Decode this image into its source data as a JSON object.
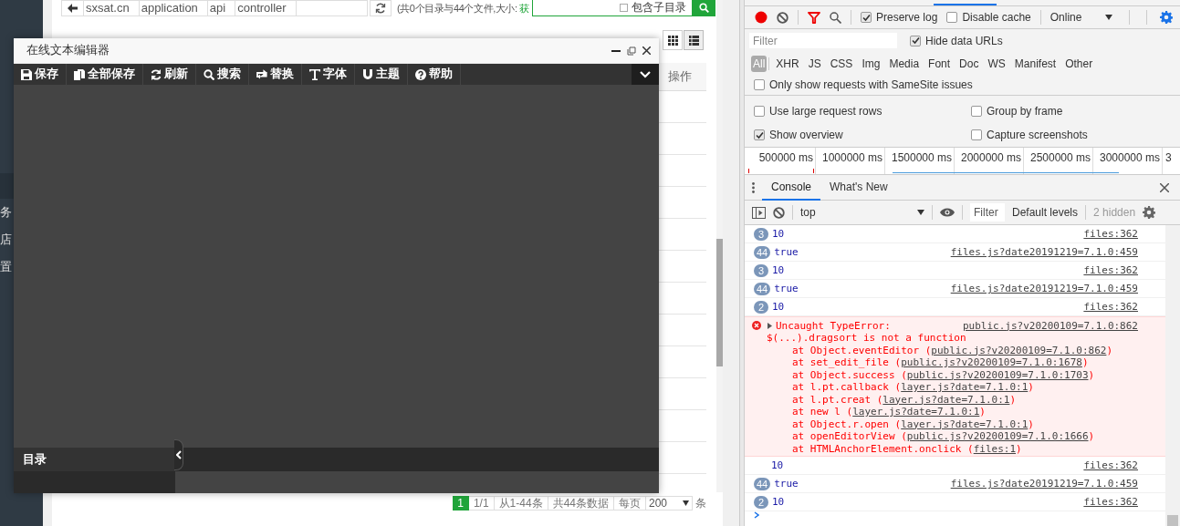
{
  "page": {
    "sidebar_items": [
      "务",
      "店",
      "置"
    ],
    "breadcrumb": [
      "sxsat.cn",
      "application",
      "api",
      "controller"
    ],
    "summary": "(共0个目录与44个文件,大小: ",
    "summary_link": "获",
    "search": {
      "option": "包含子目录",
      "checked": false
    },
    "view_modes": [
      {
        "kind": "grid",
        "selected": false
      },
      {
        "kind": "list",
        "selected": true
      }
    ],
    "table": {
      "columns": [
        "操作"
      ]
    },
    "pagination": {
      "current": "1",
      "pages": "1/1",
      "range": "从1-44条",
      "total": "共44条数据",
      "per_page_label": "每页",
      "per_page": "200",
      "unit": "条"
    }
  },
  "editor": {
    "title": "在线文本编辑器",
    "toolbar": [
      "保存",
      "全部保存",
      "刷新",
      "搜索",
      "替换",
      "字体",
      "主题",
      "帮助"
    ],
    "sidebar_title": "目录"
  },
  "devtools": {
    "network": {
      "toolbar_checks": [
        {
          "label": "Preserve log",
          "checked": true
        },
        {
          "label": "Disable cache",
          "checked": false
        }
      ],
      "throttle": "Online",
      "filter_placeholder": "Filter",
      "hide_data_urls": {
        "label": "Hide data URLs",
        "checked": true
      },
      "types": [
        {
          "label": "All",
          "selected": true
        },
        {
          "label": "XHR",
          "selected": false
        },
        {
          "label": "JS",
          "selected": false
        },
        {
          "label": "CSS",
          "selected": false
        },
        {
          "label": "Img",
          "selected": false
        },
        {
          "label": "Media",
          "selected": false
        },
        {
          "label": "Font",
          "selected": false
        },
        {
          "label": "Doc",
          "selected": false
        },
        {
          "label": "WS",
          "selected": false
        },
        {
          "label": "Manifest",
          "selected": false
        },
        {
          "label": "Other",
          "selected": false
        }
      ],
      "samesite": {
        "label": "Only show requests with SameSite issues",
        "checked": false
      },
      "options": [
        {
          "label": "Use large request rows",
          "checked": false
        },
        {
          "label": "Group by frame",
          "checked": false
        },
        {
          "label": "Show overview",
          "checked": true
        },
        {
          "label": "Capture screenshots",
          "checked": false
        }
      ],
      "timeline_ticks": [
        "500000 ms",
        "1000000 ms",
        "1500000 ms",
        "2000000 ms",
        "2500000 ms",
        "3000000 ms",
        "3"
      ]
    },
    "drawer_tabs": [
      {
        "label": "Console",
        "selected": true
      },
      {
        "label": "What's New",
        "selected": false
      }
    ],
    "console": {
      "context": "top",
      "filter_placeholder": "Filter",
      "levels": "Default levels",
      "hidden": "2 hidden",
      "messages": [
        {
          "kind": "log",
          "count": "3",
          "value": "10",
          "source": "files:362"
        },
        {
          "kind": "log",
          "count": "44",
          "value": "true",
          "source": "files.js?date20191219=7.1.0:459"
        },
        {
          "kind": "log",
          "count": "3",
          "value": "10",
          "source": "files:362"
        },
        {
          "kind": "log",
          "count": "44",
          "value": "true",
          "source": "files.js?date20191219=7.1.0:459"
        },
        {
          "kind": "log",
          "count": "2",
          "value": "10",
          "source": "files:362"
        },
        {
          "kind": "error",
          "value": "Uncaught TypeError:",
          "source": "public.js?v20200109=7.1.0:862",
          "message": "$(...).dragsort is not a function",
          "stack": [
            {
              "prefix": "at Object.eventEditor (",
              "link": "public.js?v20200109=7.1.0:862",
              "suffix": ")"
            },
            {
              "prefix": "at set_edit_file (",
              "link": "public.js?v20200109=7.1.0:1678",
              "suffix": ")"
            },
            {
              "prefix": "at Object.success (",
              "link": "public.js?v20200109=7.1.0:1703",
              "suffix": ")"
            },
            {
              "prefix": "at l.pt.callback (",
              "link": "layer.js?date=7.1.0:1",
              "suffix": ")"
            },
            {
              "prefix": "at l.pt.creat (",
              "link": "layer.js?date=7.1.0:1",
              "suffix": ")"
            },
            {
              "prefix": "at new l (",
              "link": "layer.js?date=7.1.0:1",
              "suffix": ")"
            },
            {
              "prefix": "at Object.r.open (",
              "link": "layer.js?date=7.1.0:1",
              "suffix": ")"
            },
            {
              "prefix": "at openEditorView (",
              "link": "public.js?v20200109=7.1.0:1666",
              "suffix": ")"
            },
            {
              "prefix": "at HTMLAnchorElement.onclick (",
              "link": "files:1",
              "suffix": ")"
            }
          ]
        },
        {
          "kind": "log",
          "value": "10",
          "source": "files:362"
        },
        {
          "kind": "log",
          "count": "44",
          "value": "true",
          "source": "files.js?date20191219=7.1.0:459"
        },
        {
          "kind": "log",
          "count": "2",
          "value": "10",
          "source": "files:362"
        }
      ]
    }
  }
}
